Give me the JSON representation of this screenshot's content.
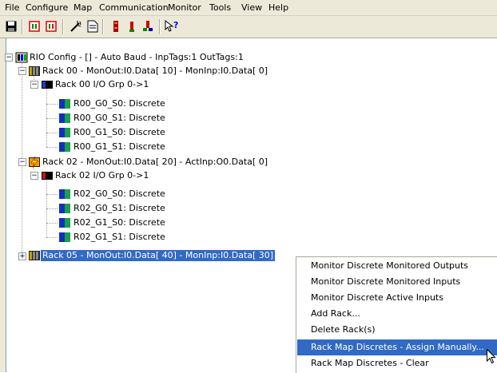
{
  "menubar": {
    "items": [
      "File",
      "Configure",
      "Map",
      "Communication",
      "Monitor",
      "Tools",
      "View",
      "Help"
    ]
  },
  "toolbar": {
    "buttons": [
      "save-icon",
      "plc-read-icon",
      "plc-write-icon",
      "wizard-icon",
      "document-icon",
      "io-module-icon",
      "rack-icon",
      "connect-icon",
      "context-help-icon"
    ]
  },
  "tree": {
    "root": "RIO Config - [] - Auto Baud - InpTags:1 OutTags:1",
    "rack00": "Rack 00 - MonOut:I0.Data[ 10] - MonInp:I0.Data[ 0]",
    "rack00_grp": "Rack 00 I/O Grp 0->1",
    "rack00_slots": [
      "R00_G0_S0: Discrete",
      "R00_G0_S1: Discrete",
      "R00_G1_S0: Discrete",
      "R00_G1_S1: Discrete"
    ],
    "rack02": "Rack 02 - MonOut:I0.Data[ 20] - ActInp:O0.Data[ 0]",
    "rack02_grp": "Rack 02 I/O Grp 0->1",
    "rack02_slots": [
      "R02_G0_S0: Discrete",
      "R02_G0_S1: Discrete",
      "R02_G1_S0: Discrete",
      "R02_G1_S1: Discrete"
    ],
    "rack05": "Rack 05 - MonOut:I0.Data[ 40] - MonInp:I0.Data[ 30]"
  },
  "context_menu": {
    "items": [
      "Monitor Discrete Monitored Outputs",
      "Monitor Discrete Monitored Inputs",
      "Monitor Discrete Active Inputs",
      "Add Rack...",
      "Delete Rack(s)",
      "Rack Map Discretes - Assign Manually...",
      "Rack Map Discretes - Clear"
    ],
    "highlighted_index": 5
  },
  "colors": {
    "selection": "#316ac5",
    "chrome": "#ece9d8"
  }
}
